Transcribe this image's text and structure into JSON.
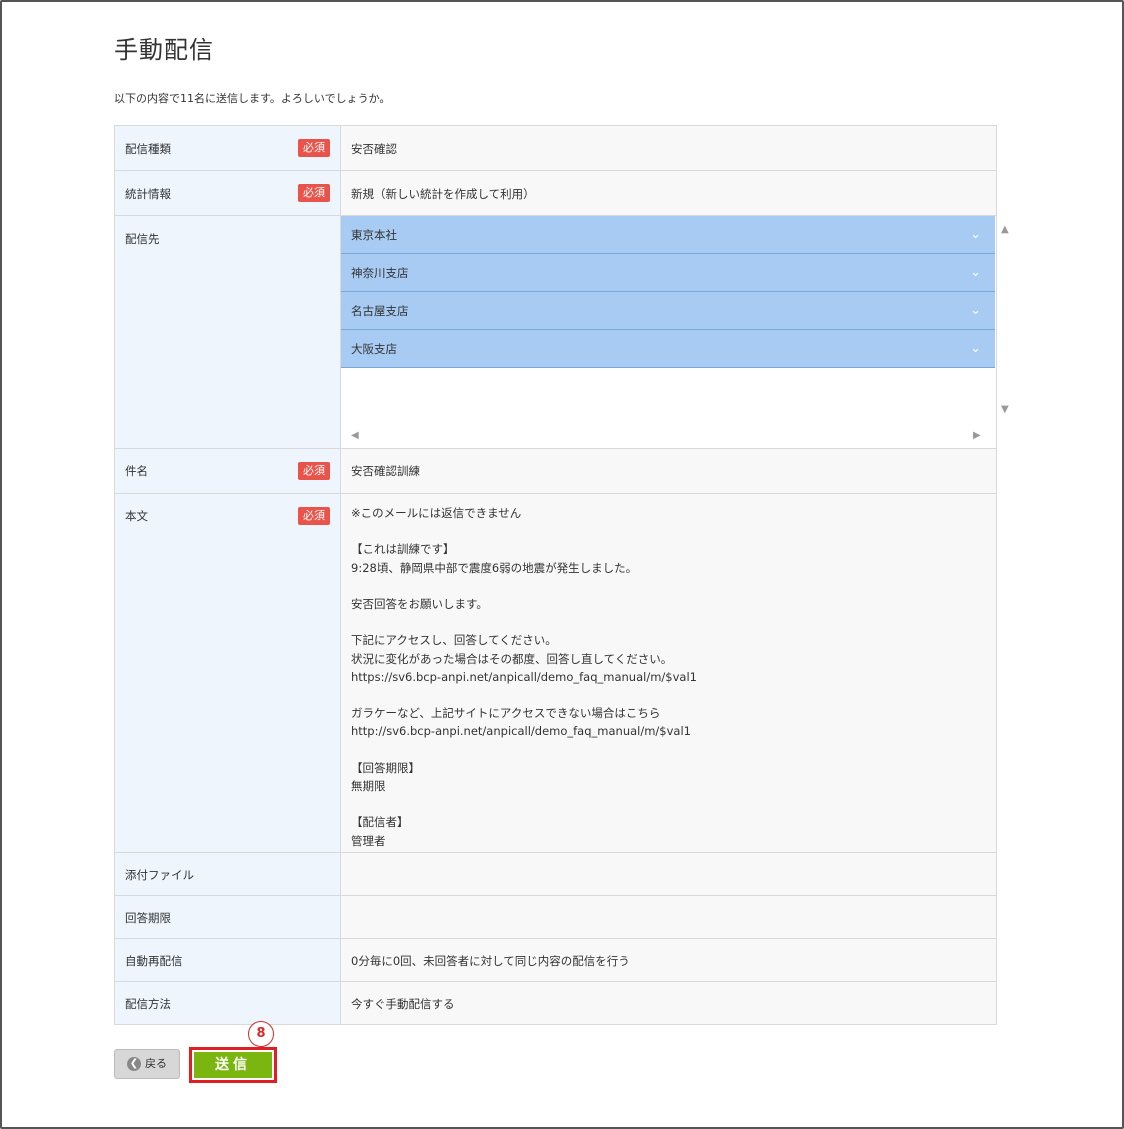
{
  "page": {
    "title": "手動配信",
    "confirm_text": "以下の内容で11名に送信します。よろしいでしょうか。"
  },
  "form": {
    "required_badge": "必須",
    "rows": {
      "kind": {
        "label": "配信種類",
        "value": "安否確認"
      },
      "stats": {
        "label": "統計情報",
        "value": "新規（新しい統計を作成して利用）"
      },
      "dest": {
        "label": "配信先",
        "items": [
          "東京本社",
          "神奈川支店",
          "名古屋支店",
          "大阪支店"
        ]
      },
      "subject": {
        "label": "件名",
        "value": "安否確認訓練"
      },
      "body": {
        "label": "本文",
        "value": "※このメールには返信できません\n\n【これは訓練です】\n9:28頃、静岡県中部で震度6弱の地震が発生しました。\n\n安否回答をお願いします。\n\n下記にアクセスし、回答してください。\n状況に変化があった場合はその都度、回答し直してください。\nhttps://sv6.bcp-anpi.net/anpicall/demo_faq_manual/m/$val1\n\nガラケーなど、上記サイトにアクセスできない場合はこちら\nhttp://sv6.bcp-anpi.net/anpicall/demo_faq_manual/m/$val1\n\n【回答期限】\n無期限\n\n【配信者】\n管理者"
      },
      "attachment": {
        "label": "添付ファイル",
        "value": ""
      },
      "deadline": {
        "label": "回答期限",
        "value": ""
      },
      "resend": {
        "label": "自動再配信",
        "value": "0分毎に0回、未回答者に対して同じ内容の配信を行う"
      },
      "method": {
        "label": "配信方法",
        "value": "今すぐ手動配信する"
      }
    }
  },
  "actions": {
    "back_label": "戻る",
    "send_label": "送信",
    "step_number": "8"
  }
}
